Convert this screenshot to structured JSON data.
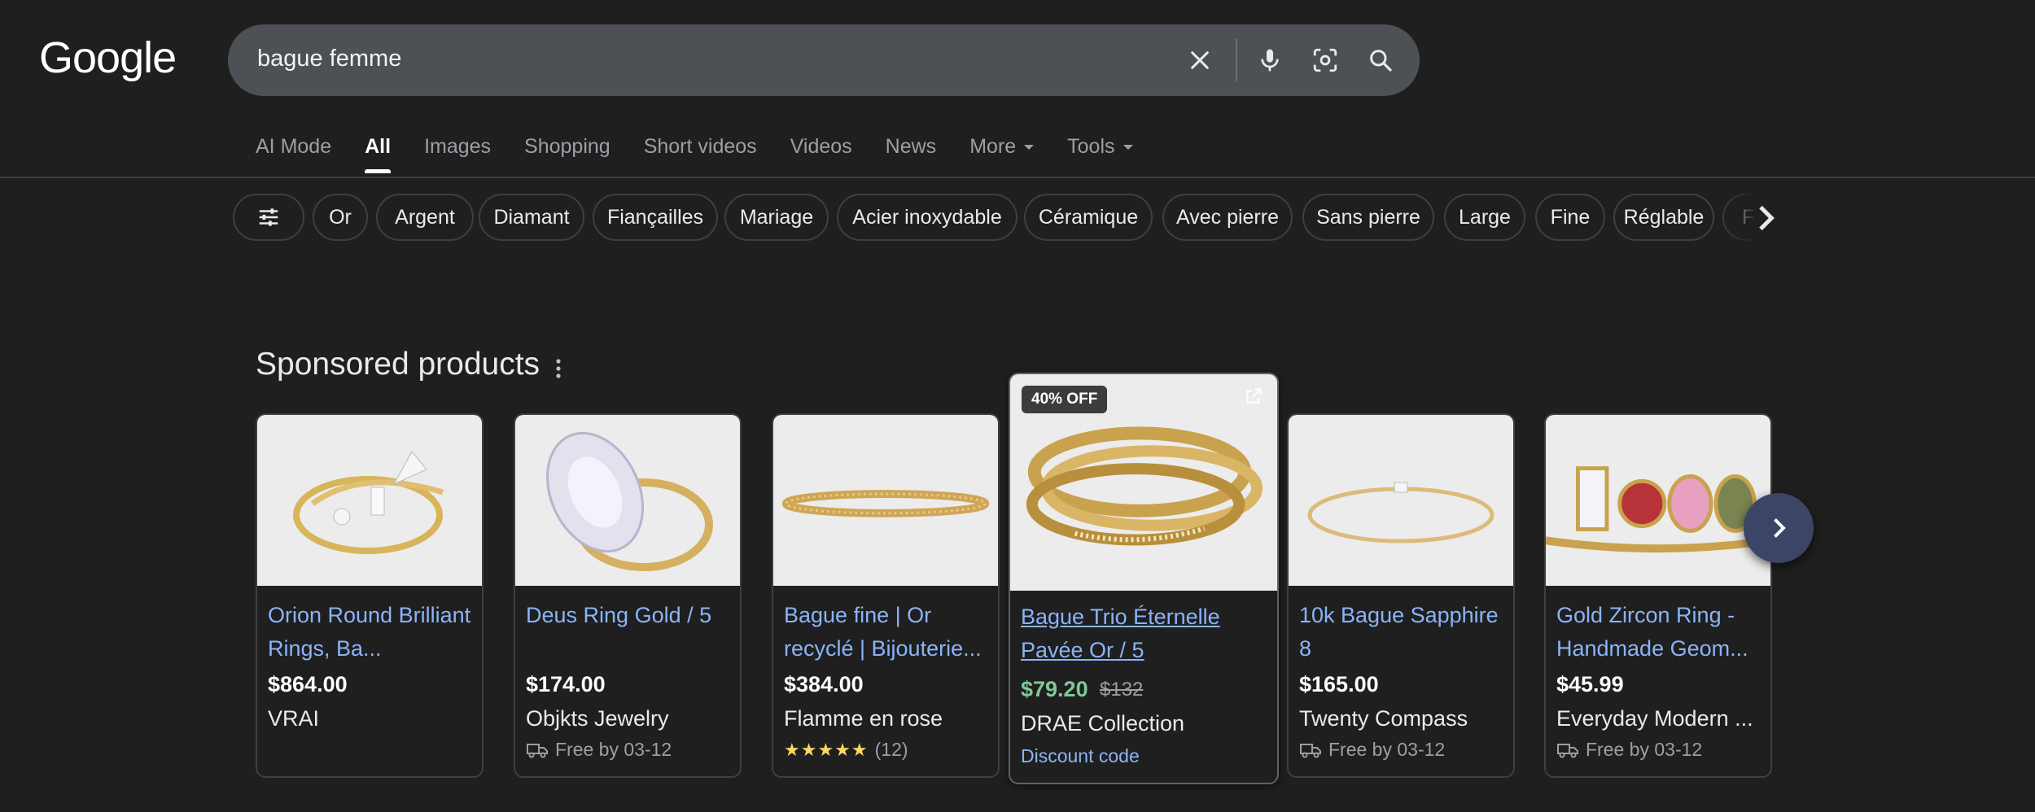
{
  "header": {
    "logo": "Google"
  },
  "search": {
    "query": "bague femme"
  },
  "tabs": [
    {
      "label": "AI Mode"
    },
    {
      "label": "All"
    },
    {
      "label": "Images"
    },
    {
      "label": "Shopping"
    },
    {
      "label": "Short videos"
    },
    {
      "label": "Videos"
    },
    {
      "label": "News"
    },
    {
      "label": "More"
    },
    {
      "label": "Tools"
    }
  ],
  "chips": [
    "Or",
    "Argent",
    "Diamant",
    "Fiançailles",
    "Mariage",
    "Acier inoxydable",
    "Céramique",
    "Avec pierre",
    "Sans pierre",
    "Large",
    "Fine",
    "Réglable",
    "F"
  ],
  "sponsored": {
    "title": "Sponsored products",
    "products": [
      {
        "title": "Orion Round Brilliant Rings, Ba...",
        "price": "$864.00",
        "merchant": "VRAI"
      },
      {
        "title": "Deus Ring Gold / 5",
        "price": "$174.00",
        "merchant": "Objkts Jewelry",
        "shipping": "Free by 03-12"
      },
      {
        "title": "Bague fine | Or recyclé | Bijouterie...",
        "price": "$384.00",
        "merchant": "Flamme en rose",
        "rating_count": "(12)",
        "rating": 5
      },
      {
        "badge": "40% OFF",
        "title": "Bague Trio Éternelle Pavée Or / 5",
        "price": "$79.20",
        "old_price": "$132",
        "merchant": "DRAE Collection",
        "discount": "Discount code"
      },
      {
        "title": "10k Bague Sapphire 8",
        "price": "$165.00",
        "merchant": "Twenty Compass",
        "shipping": "Free by 03-12"
      },
      {
        "title": "Gold Zircon Ring - Handmade Geom...",
        "price": "$45.99",
        "merchant": "Everyday Modern ...",
        "shipping": "Free by 03-12"
      }
    ]
  },
  "colors": {
    "background": "#1f1f1f",
    "link": "#8ab4f8",
    "sale_price": "#81c995",
    "star": "#fdd663"
  }
}
